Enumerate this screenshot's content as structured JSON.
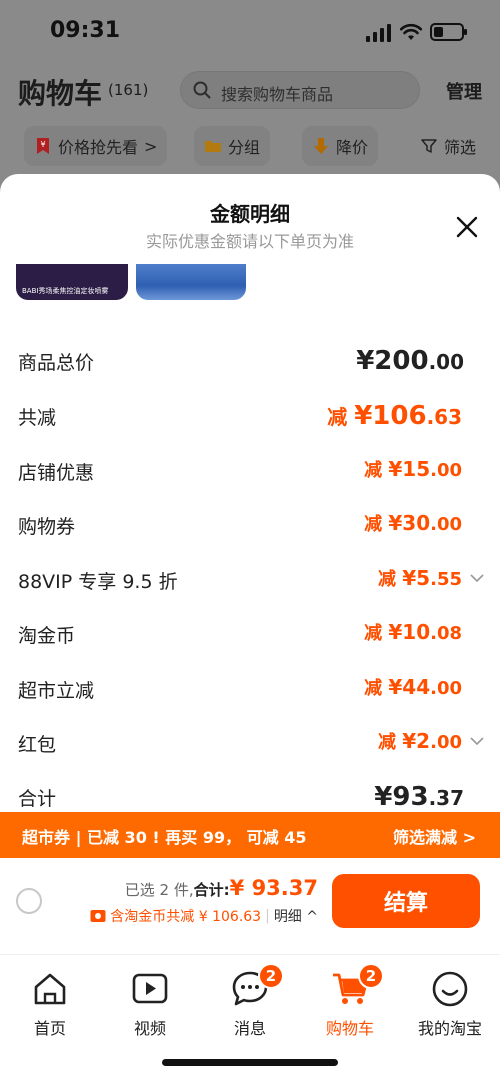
{
  "status_bar": {
    "time": "09:31"
  },
  "header": {
    "title": "购物车",
    "count": "(161)",
    "search_placeholder": "搜索购物车商品",
    "manage_label": "管理"
  },
  "filters": [
    {
      "label": "价格抢先看",
      "suffix": ">"
    },
    {
      "label": "分组"
    },
    {
      "label": "降价"
    },
    {
      "label": "筛选"
    }
  ],
  "sheet": {
    "title": "金额明细",
    "subtitle": "实际优惠金额请以下单页为准",
    "thumb_caption": "BABI秀场柔焦控油定妆喷雾",
    "rows": [
      {
        "label": "商品总价",
        "prefix": "",
        "yuan": "¥200",
        "cents": ".00"
      },
      {
        "label": "共减",
        "prefix": "减 ",
        "yuan": "¥106",
        "cents": ".63"
      },
      {
        "label": "店铺优惠",
        "prefix": "减 ",
        "yuan": "¥15",
        "cents": ".00"
      },
      {
        "label": "购物券",
        "prefix": "减 ",
        "yuan": "¥30",
        "cents": ".00"
      },
      {
        "label": "88VIP 专享 9.5 折",
        "prefix": "减 ",
        "yuan": "¥5",
        "cents": ".55"
      },
      {
        "label": "淘金币",
        "prefix": "减 ",
        "yuan": "¥10",
        "cents": ".08"
      },
      {
        "label": "超市立减",
        "prefix": "减 ",
        "yuan": "¥44",
        "cents": ".00"
      },
      {
        "label": "红包",
        "prefix": "减 ",
        "yuan": "¥2",
        "cents": ".00"
      },
      {
        "label": "合计",
        "prefix": "",
        "yuan": "¥93",
        "cents": ".37"
      }
    ]
  },
  "promo": {
    "left": "超市券 | 已减 30 ! 再买 99， 可减 45",
    "right": "筛选满减 >"
  },
  "checkout": {
    "selected": "已选 2 件,",
    "total_label": "合计:",
    "total_amount": "¥ 93.37",
    "discount_text": "含淘金币共减 ¥ 106.63",
    "sep": "|",
    "detail_label": "明细 ^",
    "pay_label": "结算"
  },
  "tabs": [
    {
      "label": "首页",
      "icon": "home-icon"
    },
    {
      "label": "视频",
      "icon": "video-icon"
    },
    {
      "label": "消息",
      "icon": "message-icon",
      "badge": "2"
    },
    {
      "label": "购物车",
      "icon": "cart-icon",
      "badge": "2",
      "active": true
    },
    {
      "label": "我的淘宝",
      "icon": "profile-icon"
    }
  ],
  "colors": {
    "accent": "#ff5000",
    "promo": "#ff6a00",
    "overlay": "#8a8a8a"
  }
}
